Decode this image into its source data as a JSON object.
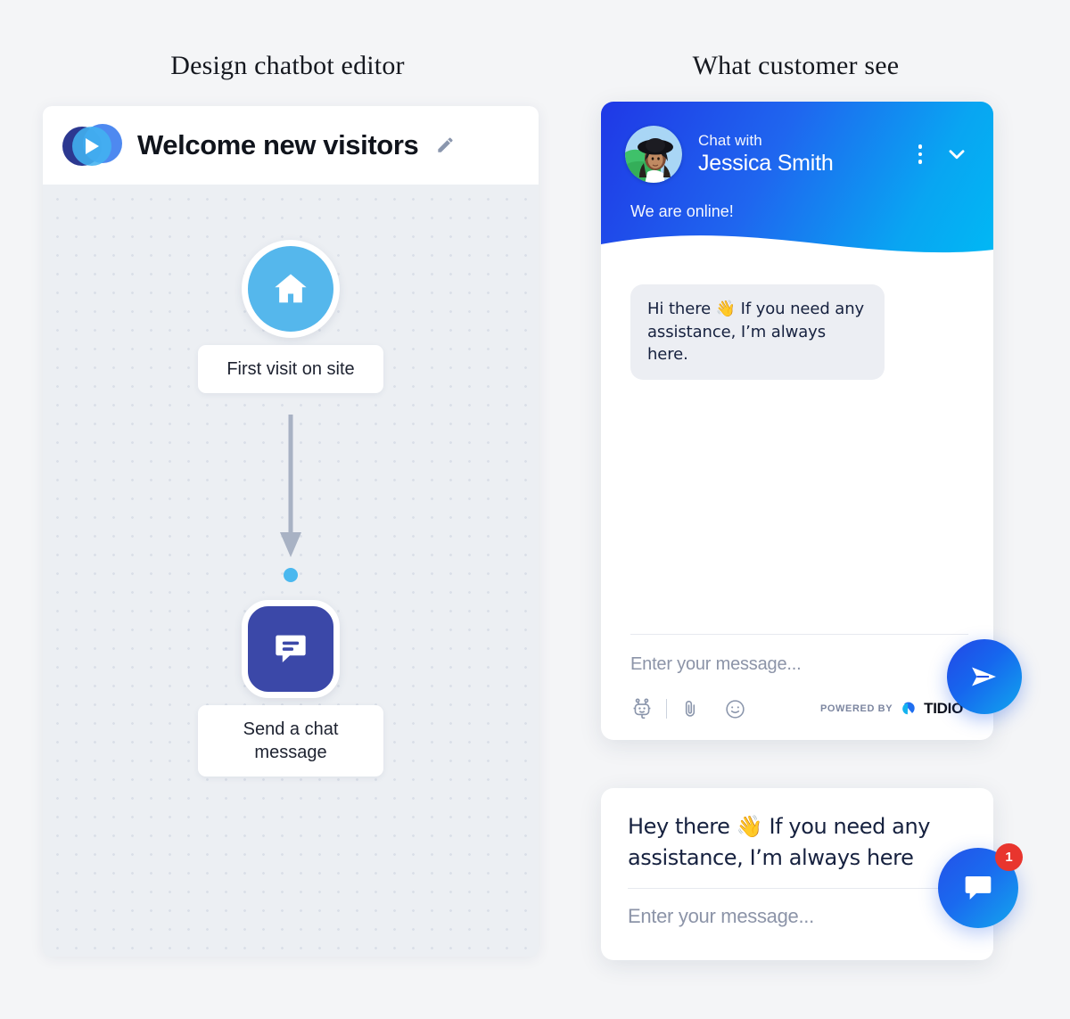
{
  "headings": {
    "left": "Design chatbot editor",
    "right": "What customer see"
  },
  "editor": {
    "logo_icon": "tidio-play-logo-icon",
    "title": "Welcome new visitors",
    "edit_icon": "pencil-edit-icon",
    "nodes": [
      {
        "icon": "home-icon",
        "label": "First visit on site",
        "color": "#55b7ec",
        "shape": "circle"
      },
      {
        "icon": "chat-message-icon",
        "label": "Send a chat\nmessage",
        "label_line1": "Send a chat",
        "label_line2": "message",
        "color": "#3b48a8",
        "shape": "rounded-square"
      }
    ],
    "connector": {
      "arrow_icon": "down-arrow-icon",
      "dot_color": "#4ab8ef",
      "arrow_color": "#a8b2c4"
    }
  },
  "chat_widget": {
    "header": {
      "gradient_from": "#1f38e6",
      "gradient_to": "#00b9f4",
      "avatar_name": "agent-avatar",
      "chat_with_label": "Chat with",
      "agent_name": "Jessica Smith",
      "menu_icon": "more-vertical-icon",
      "minimize_icon": "chevron-down-icon",
      "status": "We are online!"
    },
    "messages": [
      {
        "sender": "agent",
        "text": "Hi there 👋 If you need any assistance, I’m always here."
      }
    ],
    "input": {
      "placeholder": "Enter your message...",
      "tools": [
        {
          "icon": "bot-icon"
        },
        {
          "icon": "attachment-paperclip-icon"
        },
        {
          "icon": "emoji-smiley-icon"
        }
      ],
      "powered_by_label": "POWERED BY",
      "brand": "TIDIO",
      "brand_logo_icon": "tidio-drop-logo-icon",
      "send_icon": "send-paper-plane-icon",
      "send_color": "#2347e6"
    }
  },
  "teaser": {
    "message": "Hey there 👋 If you need any assistance, I’m always here",
    "message_line1": "Hey there 👋 If you need any",
    "message_line2": "assistance, I’m always here",
    "placeholder": "Enter your message...",
    "fab": {
      "icon": "chat-bubble-icon",
      "badge_count": "1",
      "badge_color": "#e8352e",
      "color": "#2451e8"
    }
  }
}
